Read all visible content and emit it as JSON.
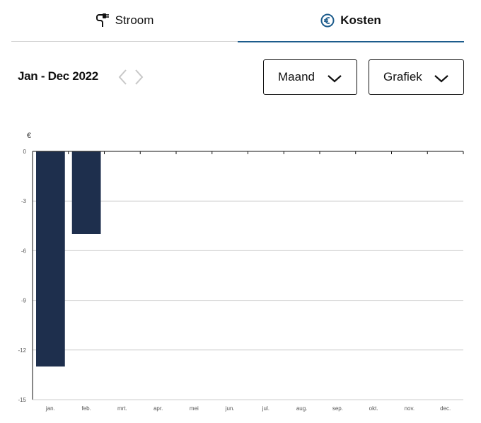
{
  "tabs": {
    "stroom_label": "Stroom",
    "kosten_label": "Kosten"
  },
  "period": "Jan - Dec 2022",
  "dropdowns": {
    "interval": "Maand",
    "view": "Grafiek"
  },
  "colors": {
    "bar": "#1e2f4d",
    "active_tab": "#1d5c8c",
    "grid": "#cccccc"
  },
  "chart_data": {
    "type": "bar",
    "ylabel": "€",
    "ylim": [
      -15,
      0
    ],
    "yticks": [
      0,
      -3,
      -6,
      -9,
      -12,
      -15
    ],
    "grid": true,
    "categories": [
      "jan.",
      "feb.",
      "mrt.",
      "apr.",
      "mei",
      "jun.",
      "jul.",
      "aug.",
      "sep.",
      "okt.",
      "nov.",
      "dec."
    ],
    "values": [
      -13,
      -5,
      0,
      0,
      0,
      0,
      0,
      0,
      0,
      0,
      0,
      0
    ]
  }
}
